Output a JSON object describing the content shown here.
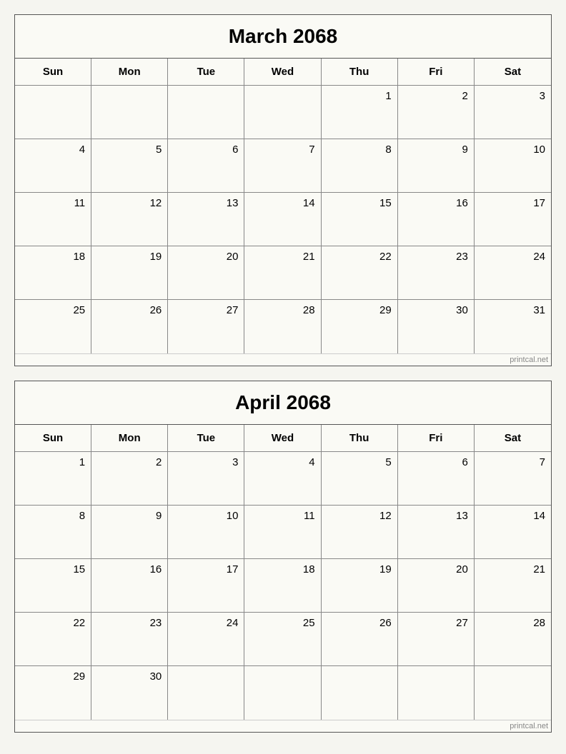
{
  "march": {
    "title": "March 2068",
    "headers": [
      "Sun",
      "Mon",
      "Tue",
      "Wed",
      "Thu",
      "Fri",
      "Sat"
    ],
    "weeks": [
      [
        {
          "day": "",
          "empty": true
        },
        {
          "day": "",
          "empty": true
        },
        {
          "day": "",
          "empty": true
        },
        {
          "day": "",
          "empty": true
        },
        {
          "day": "1",
          "empty": false
        },
        {
          "day": "2",
          "empty": false
        },
        {
          "day": "3",
          "empty": false
        }
      ],
      [
        {
          "day": "4",
          "empty": false
        },
        {
          "day": "5",
          "empty": false
        },
        {
          "day": "6",
          "empty": false
        },
        {
          "day": "7",
          "empty": false
        },
        {
          "day": "8",
          "empty": false
        },
        {
          "day": "9",
          "empty": false
        },
        {
          "day": "10",
          "empty": false
        }
      ],
      [
        {
          "day": "11",
          "empty": false
        },
        {
          "day": "12",
          "empty": false
        },
        {
          "day": "13",
          "empty": false
        },
        {
          "day": "14",
          "empty": false
        },
        {
          "day": "15",
          "empty": false
        },
        {
          "day": "16",
          "empty": false
        },
        {
          "day": "17",
          "empty": false
        }
      ],
      [
        {
          "day": "18",
          "empty": false
        },
        {
          "day": "19",
          "empty": false
        },
        {
          "day": "20",
          "empty": false
        },
        {
          "day": "21",
          "empty": false
        },
        {
          "day": "22",
          "empty": false
        },
        {
          "day": "23",
          "empty": false
        },
        {
          "day": "24",
          "empty": false
        }
      ],
      [
        {
          "day": "25",
          "empty": false
        },
        {
          "day": "26",
          "empty": false
        },
        {
          "day": "27",
          "empty": false
        },
        {
          "day": "28",
          "empty": false
        },
        {
          "day": "29",
          "empty": false
        },
        {
          "day": "30",
          "empty": false
        },
        {
          "day": "31",
          "empty": false
        }
      ]
    ]
  },
  "april": {
    "title": "April 2068",
    "headers": [
      "Sun",
      "Mon",
      "Tue",
      "Wed",
      "Thu",
      "Fri",
      "Sat"
    ],
    "weeks": [
      [
        {
          "day": "1",
          "empty": false
        },
        {
          "day": "2",
          "empty": false
        },
        {
          "day": "3",
          "empty": false
        },
        {
          "day": "4",
          "empty": false
        },
        {
          "day": "5",
          "empty": false
        },
        {
          "day": "6",
          "empty": false
        },
        {
          "day": "7",
          "empty": false
        }
      ],
      [
        {
          "day": "8",
          "empty": false
        },
        {
          "day": "9",
          "empty": false
        },
        {
          "day": "10",
          "empty": false
        },
        {
          "day": "11",
          "empty": false
        },
        {
          "day": "12",
          "empty": false
        },
        {
          "day": "13",
          "empty": false
        },
        {
          "day": "14",
          "empty": false
        }
      ],
      [
        {
          "day": "15",
          "empty": false
        },
        {
          "day": "16",
          "empty": false
        },
        {
          "day": "17",
          "empty": false
        },
        {
          "day": "18",
          "empty": false
        },
        {
          "day": "19",
          "empty": false
        },
        {
          "day": "20",
          "empty": false
        },
        {
          "day": "21",
          "empty": false
        }
      ],
      [
        {
          "day": "22",
          "empty": false
        },
        {
          "day": "23",
          "empty": false
        },
        {
          "day": "24",
          "empty": false
        },
        {
          "day": "25",
          "empty": false
        },
        {
          "day": "26",
          "empty": false
        },
        {
          "day": "27",
          "empty": false
        },
        {
          "day": "28",
          "empty": false
        }
      ],
      [
        {
          "day": "29",
          "empty": false
        },
        {
          "day": "30",
          "empty": false
        },
        {
          "day": "",
          "empty": true
        },
        {
          "day": "",
          "empty": true
        },
        {
          "day": "",
          "empty": true
        },
        {
          "day": "",
          "empty": true
        },
        {
          "day": "",
          "empty": true
        }
      ]
    ]
  },
  "watermark": "printcal.net"
}
